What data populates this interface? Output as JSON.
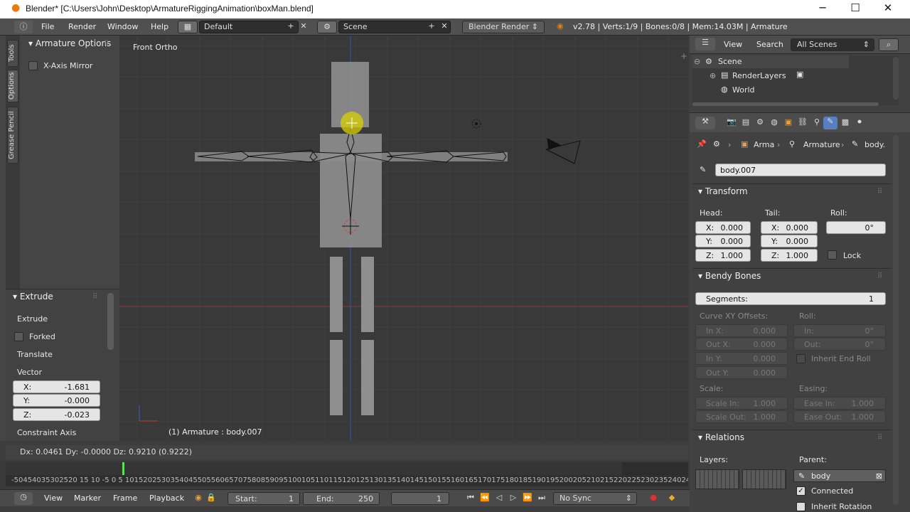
{
  "window": {
    "title": "Blender* [C:\\Users\\John\\Desktop\\ArmatureRiggingAnimation\\boxMan.blend]",
    "minimize": "─",
    "maximize": "☐",
    "close": "✕"
  },
  "infobar": {
    "menu": [
      "File",
      "Render",
      "Window",
      "Help"
    ],
    "layout": "Default",
    "scene": "Scene",
    "engine": "Blender Render",
    "stats": "v2.78 | Verts:1/9 | Bones:0/8 | Mem:14.03M | Armature"
  },
  "toolshelf": {
    "tabs": [
      "Tools",
      "Options",
      "Grease Pencil"
    ],
    "armature_options_title": "Armature Options",
    "xaxis_mirror": "X-Axis Mirror",
    "extrude_title": "Extrude",
    "extrude_label": "Extrude",
    "forked": "Forked",
    "translate": "Translate",
    "vector": "Vector",
    "vec_x_label": "X:",
    "vec_x": "-1.681",
    "vec_y_label": "Y:",
    "vec_y": "-0.000",
    "vec_z_label": "Z:",
    "vec_z": "-0.023",
    "constraint_axis": "Constraint Axis"
  },
  "viewport": {
    "view_name": "Front Ortho",
    "object_info": "(1) Armature : body.007"
  },
  "statusline": "Dx: 0.0461   Dy: -0.0000   Dz: 0.9210 (0.9222)",
  "timeline_ruler": "-50454035302520 15 10 -5  0  5 1015202530354045505560657075808590951001051101151201251301351401451501551601651701751801851901952002052102152202252302352402452502552602652702758",
  "timeline_bar": {
    "menu": [
      "View",
      "Marker",
      "Frame",
      "Playback"
    ],
    "start_label": "Start:",
    "start": "1",
    "end_label": "End:",
    "end": "250",
    "current": "1",
    "sync": "No Sync"
  },
  "outliner": {
    "menu_view": "View",
    "menu_search": "Search",
    "filter": "All Scenes",
    "scene": "Scene",
    "renderlayers": "RenderLayers",
    "world": "World"
  },
  "properties": {
    "breadcrumb_arma": "Arma",
    "breadcrumb_armature": "Armature",
    "breadcrumb_bone": "body.",
    "bone_name": "body.007",
    "transform_title": "Transform",
    "head_label": "Head:",
    "tail_label": "Tail:",
    "roll_label": "Roll:",
    "head": {
      "x": "0.000",
      "y": "0.000",
      "z": "1.000"
    },
    "tail": {
      "x": "0.000",
      "y": "0.000",
      "z": "1.000"
    },
    "roll": "0°",
    "lock": "Lock",
    "bendy_title": "Bendy Bones",
    "segments_label": "Segments:",
    "segments": "1",
    "curve_offsets": "Curve XY Offsets:",
    "roll2": "Roll:",
    "in_x_label": "In X:",
    "in_x": "0.000",
    "out_x_label": "Out X:",
    "out_x": "0.000",
    "in_y_label": "In Y:",
    "in_y": "0.000",
    "out_y_label": "Out Y:",
    "out_y": "0.000",
    "roll_in_label": "In:",
    "roll_in": "0°",
    "roll_out_label": "Out:",
    "roll_out": "0°",
    "inherit_end_roll": "Inherit End Roll",
    "scale_label": "Scale:",
    "easing_label": "Easing:",
    "scale_in_label": "Scale In:",
    "scale_in": "1.000",
    "scale_out_label": "Scale Out:",
    "scale_out": "1.000",
    "ease_in_label": "Ease In:",
    "ease_in": "1.000",
    "ease_out_label": "Ease Out:",
    "ease_out": "1.000",
    "relations_title": "Relations",
    "layers_label": "Layers:",
    "parent_label": "Parent:",
    "parent": "body",
    "connected": "Connected",
    "inherit_rotation": "Inherit Rotation"
  },
  "axis_labels": {
    "x": "X",
    "y": "Y",
    "z": "Z"
  },
  "colors": {
    "accent_blue": "#5680c2",
    "cursor_yellow": "#e0d000",
    "x_axis": "#a33a3a",
    "z_axis": "#2d4f8a"
  }
}
